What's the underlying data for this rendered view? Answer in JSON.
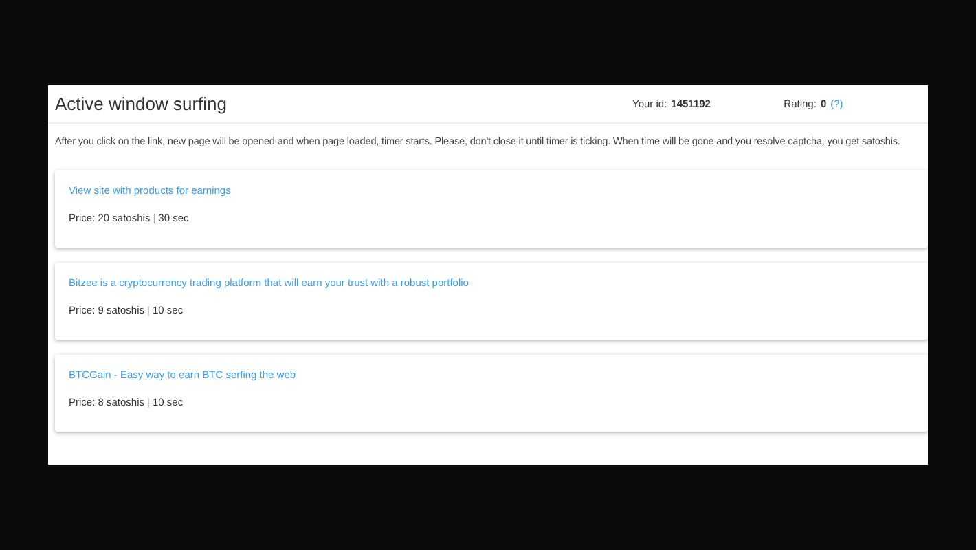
{
  "page": {
    "title": "Active window surfing",
    "user_id_label": "Your id:",
    "user_id": "1451192",
    "rating_label": "Rating:",
    "rating": "0",
    "rating_help": "(?)"
  },
  "description": "After you click on the link, new page will be opened and when page loaded, timer starts. Please, don't close it until timer is ticking. When time will be gone and you resolve captcha, you get satoshis.",
  "offers": [
    {
      "title": "View site with products for earnings",
      "price": "Price: 20 satoshis",
      "separator": "|",
      "duration": "30 sec"
    },
    {
      "title": "Bitzee is a cryptocurrency trading platform that will earn your trust with a robust portfolio",
      "price": "Price: 9 satoshis",
      "separator": "|",
      "duration": "10 sec"
    },
    {
      "title": "BTCGain - Easy way to earn BTC serfing the web",
      "price": "Price: 8 satoshis",
      "separator": "|",
      "duration": "10 sec"
    }
  ]
}
